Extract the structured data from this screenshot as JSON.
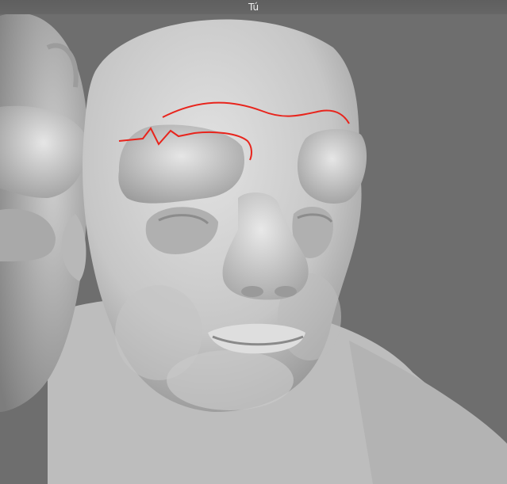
{
  "window": {
    "title": "Tú"
  },
  "viewport": {
    "background_color": "#6e6e6e",
    "mesh_color": "#c8c8c8",
    "annotation_color": "#e8241c"
  }
}
